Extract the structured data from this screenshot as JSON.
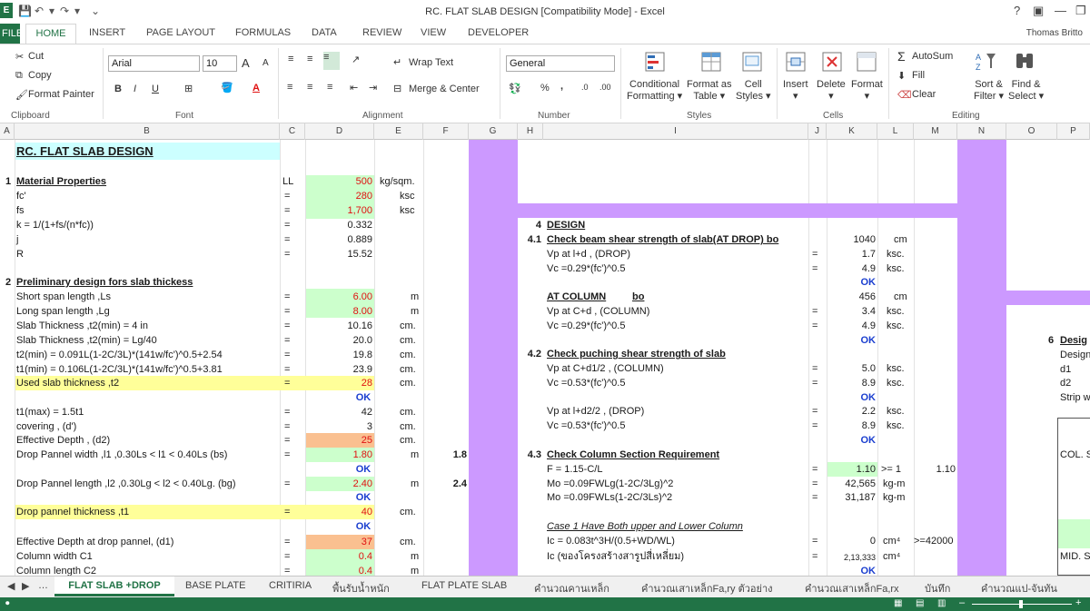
{
  "window": {
    "title": "RC. FLAT SLAB DESIGN  [Compatibility Mode] - Excel",
    "help": "?",
    "app_badge": "E",
    "user": "Thomas Britto"
  },
  "ribbon_tabs": {
    "file": "FILE",
    "home": "HOME",
    "insert": "INSERT",
    "page_layout": "PAGE LAYOUT",
    "formulas": "FORMULAS",
    "data": "DATA",
    "review": "REVIEW",
    "view": "VIEW",
    "developer": "DEVELOPER"
  },
  "clipboard": {
    "cut": "Cut",
    "copy": "Copy",
    "format_painter": "Format Painter",
    "label": "Clipboard"
  },
  "font": {
    "name": "Arial",
    "size": "10",
    "grow": "A",
    "shrink": "A",
    "bold": "B",
    "italic": "I",
    "underline": "U",
    "color_a": "A",
    "label": "Font"
  },
  "alignment": {
    "wrap": "Wrap Text",
    "merge": "Merge & Center",
    "label": "Alignment"
  },
  "number": {
    "format": "General",
    "percent": "%",
    "comma": ",",
    "inc": ".0",
    "dec": ".00",
    "label": "Number"
  },
  "styles": {
    "conditional": "Conditional",
    "conditional2": "Formatting",
    "format_as": "Format as",
    "format_as2": "Table",
    "cell": "Cell",
    "cell2": "Styles",
    "label": "Styles"
  },
  "cells": {
    "insert": "Insert",
    "delete": "Delete",
    "format": "Format",
    "label": "Cells"
  },
  "editing": {
    "autosum": "AutoSum",
    "fill": "Fill",
    "clear": "Clear",
    "sort": "Sort &",
    "sort2": "Filter",
    "find": "Find &",
    "find2": "Select",
    "label": "Editing"
  },
  "columns": [
    "A",
    "B",
    "C",
    "D",
    "E",
    "F",
    "G",
    "H",
    "I",
    "J",
    "K",
    "L",
    "M",
    "N",
    "O",
    "P"
  ],
  "sheet": {
    "title": "RC. FLAT SLAB DESIGN",
    "s1": {
      "num": "1",
      "title": "Material Properties"
    },
    "ll": {
      "label": "LL",
      "value": "500",
      "unit": "kg/sqm."
    },
    "fc": {
      "label": "fc'",
      "eq": "=",
      "value": "280",
      "unit": "ksc"
    },
    "fs": {
      "label": "fs",
      "eq": "=",
      "value": "1,700",
      "unit": "ksc"
    },
    "k": {
      "label": "k = 1/(1+fs/(n*fc))",
      "eq": "=",
      "value": "0.332"
    },
    "j": {
      "label": "j",
      "eq": "=",
      "value": "0.889"
    },
    "R": {
      "label": "R",
      "eq": "=",
      "value": "15.52"
    },
    "s2": {
      "num": "2",
      "title": "Preliminary design fors slab thickess"
    },
    "ls": {
      "label": "Short span length ,Ls",
      "eq": "=",
      "value": "6.00",
      "unit": "m"
    },
    "lg": {
      "label": "Long span length ,Lg",
      "eq": "=",
      "value": "8.00",
      "unit": "m"
    },
    "t2a": {
      "label": "Slab Thickness ,t2(min) = 4 in",
      "eq": "=",
      "value": "10.16",
      "unit": "cm."
    },
    "t2b": {
      "label": "Slab Thickness ,t2(min) = Lg/40",
      "eq": "=",
      "value": "20.0",
      "unit": "cm."
    },
    "t2c": {
      "label": "t2(min) = 0.091L(1-2C/3L)*(141w/fc')^0.5+2.54",
      "eq": "=",
      "value": "19.8",
      "unit": "cm."
    },
    "t1c": {
      "label": "t1(min) = 0.106L(1-2C/3L)*(141w/fc')^0.5+3.81",
      "eq": "=",
      "value": "23.9",
      "unit": "cm."
    },
    "used": {
      "label": "Used slab thickness ,t2",
      "eq": "=",
      "value": "28",
      "unit": "cm."
    },
    "ok1": "OK",
    "t1max": {
      "label": "t1(max) = 1.5t1",
      "eq": "=",
      "value": "42",
      "unit": "cm."
    },
    "cov": {
      "label": "covering , (d')",
      "eq": "=",
      "value": "3",
      "unit": "cm."
    },
    "eff": {
      "label": "Effective Depth , (d2)",
      "eq": "=",
      "value": "25",
      "unit": "cm."
    },
    "dpw": {
      "label": "Drop Pannel width ,l1 ,0.30Ls < l1 < 0.40Ls (bs)",
      "eq": "=",
      "value": "1.80",
      "unit": "m",
      "extra": "1.8"
    },
    "ok2": "OK",
    "dpl": {
      "label": "Drop Pannel length ,l2 ,0.30Lg < l2 < 0.40Lg. (bg)",
      "eq": "=",
      "value": "2.40",
      "unit": "m",
      "extra": "2.4"
    },
    "ok3": "OK",
    "dpt": {
      "label": "Drop pannel thickness ,t1",
      "eq": "=",
      "value": "40",
      "unit": "cm."
    },
    "ok4": "OK",
    "effd": {
      "label": "Effective Depth at drop pannel, (d1)",
      "eq": "=",
      "value": "37",
      "unit": "cm."
    },
    "c1": {
      "label": "Column width C1",
      "eq": "=",
      "value": "0.4",
      "unit": "m"
    },
    "c2": {
      "label": "Column length C2",
      "eq": "=",
      "value": "0.4",
      "unit": "m"
    },
    "s4": {
      "num": "4",
      "title": "DESIGN"
    },
    "s41": {
      "num": "4.1",
      "title": "Check beam shear strength of slab(AT DROP) bo",
      "value": "1040",
      "unit": "cm"
    },
    "vp1": {
      "label": "Vp at l+d    , (DROP)",
      "eq": "=",
      "value": "1.7",
      "unit": "ksc."
    },
    "vc1": {
      "label": "Vc =0.29*(fc')^0.5",
      "eq": "=",
      "value": "4.9",
      "unit": "ksc."
    },
    "ok5": "OK",
    "atcol": {
      "title": "AT COLUMN",
      "bo": "bo",
      "value": "456",
      "unit": "cm"
    },
    "vp2": {
      "label": "Vp at C+d    , (COLUMN)",
      "eq": "=",
      "value": "3.4",
      "unit": "ksc."
    },
    "vc2": {
      "label": "Vc =0.29*(fc')^0.5",
      "eq": "=",
      "value": "4.9",
      "unit": "ksc."
    },
    "ok6": "OK",
    "s42": {
      "num": "4.2",
      "title": "Check  puching shear strength of slab"
    },
    "vp3": {
      "label": "Vp at C+d1/2   , (COLUMN)",
      "eq": "=",
      "value": "5.0",
      "unit": "ksc."
    },
    "vc3": {
      "label": "Vc =0.53*(fc')^0.5",
      "eq": "=",
      "value": "8.9",
      "unit": "ksc."
    },
    "ok7": "OK",
    "vp4": {
      "label": "Vp at l+d2/2    , (DROP)",
      "eq": "=",
      "value": "2.2",
      "unit": "ksc."
    },
    "vc4": {
      "label": "Vc =0.53*(fc')^0.5",
      "eq": "=",
      "value": "8.9",
      "unit": "ksc."
    },
    "ok8": "OK",
    "s43": {
      "num": "4.3",
      "title": "Check Column Section Requirement"
    },
    "F": {
      "label": "F = 1.15-C/L",
      "eq": "=",
      "value": "1.10",
      "cmp": ">=  1",
      "extra": "1.10"
    },
    "mo1": {
      "label": "Mo =0.09FWLg(1-2C/3Lg)^2",
      "eq": "=",
      "value": "42,565",
      "unit": "kg-m"
    },
    "mo2": {
      "label": "Mo =0.09FWLs(1-2C/3Ls)^2",
      "eq": "=",
      "value": "31,187",
      "unit": "kg-m"
    },
    "case1": "Case 1 Have Both upper and Lower Column",
    "ic1": {
      "label": "Ic = 0.083t^3H/(0.5+WD/WL)",
      "eq": "=",
      "value": "0",
      "unit": "cm⁴",
      "extra": ">=42000"
    },
    "ic2": {
      "label": "Ic (ของโครงสร้างสารูปสี่เหลี่ยม)",
      "eq": "=",
      "value": "2,13,333",
      "unit": "cm⁴"
    },
    "ok9": "OK",
    "p6": {
      "num": "6",
      "title": "Desig"
    },
    "p_desig": "Design",
    "p_d1": "d1",
    "p_d2": "d2",
    "p_strip": "Strip w",
    "p_col": "COL. S",
    "p_mid": "MID. S"
  },
  "sheet_tabs": {
    "active": "FLAT SLAB +DROP",
    "t2": "BASE PLATE",
    "t3": "CRITIRIA",
    "t4": "พื้นรับน้ำหนัก",
    "t5": "FLAT PLATE SLAB",
    "t6": "คำนวณคานเหล็ก",
    "t7": "คำนวณเสาเหล็กFa,ry ตัวอย่าง",
    "t8": "คำนวณเสาเหล็กFa,rx",
    "t9": "บันทึก",
    "t10": "คำนวณแป-จันทัน"
  },
  "colors": {
    "excel_green": "#217346",
    "purple": "#cc99ff",
    "light_green": "#ccffcc",
    "yellow": "#ffff99",
    "orange": "#fac090",
    "cyan": "#ccffff",
    "red_text": "#e01010",
    "blue_text": "#1a3ecf"
  }
}
